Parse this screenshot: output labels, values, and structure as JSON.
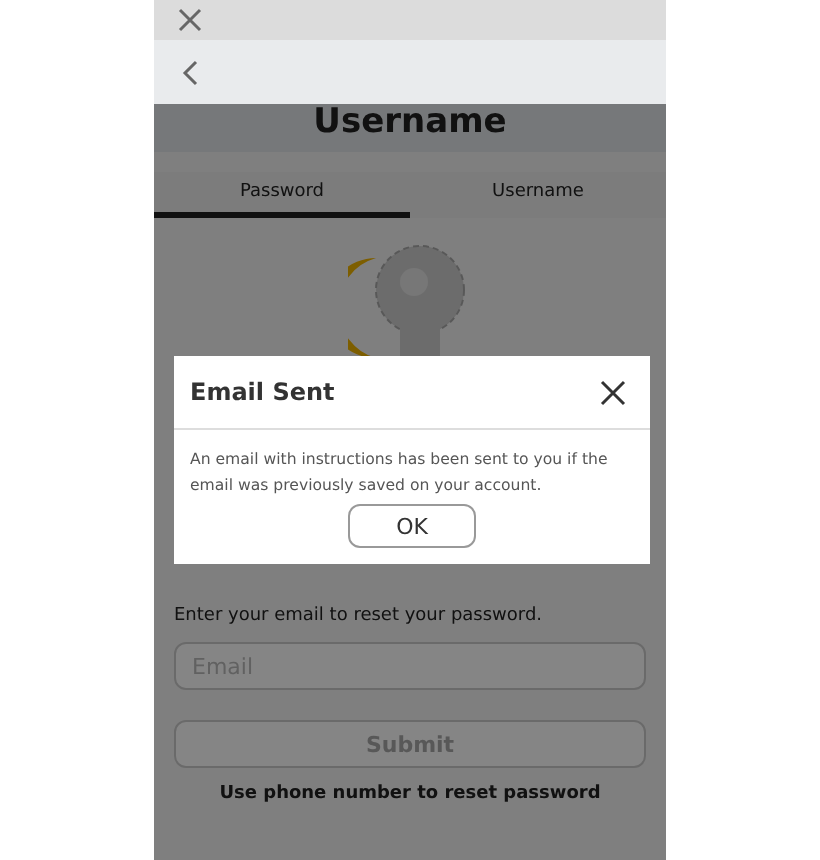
{
  "heading": "Username",
  "tabs": [
    {
      "label": "Password",
      "selected": true
    },
    {
      "label": "Username",
      "selected": false
    }
  ],
  "instructions": "Enter your email to reset your password.",
  "email_field": {
    "placeholder": "Email"
  },
  "submit_button": {
    "label": "Submit",
    "disabled": true
  },
  "phone_link": "Use phone number to reset password",
  "dialog": {
    "title": "Email Sent",
    "message": "An email with instructions has been sent to you if the email was previously saved on your account.",
    "button": "OK"
  }
}
